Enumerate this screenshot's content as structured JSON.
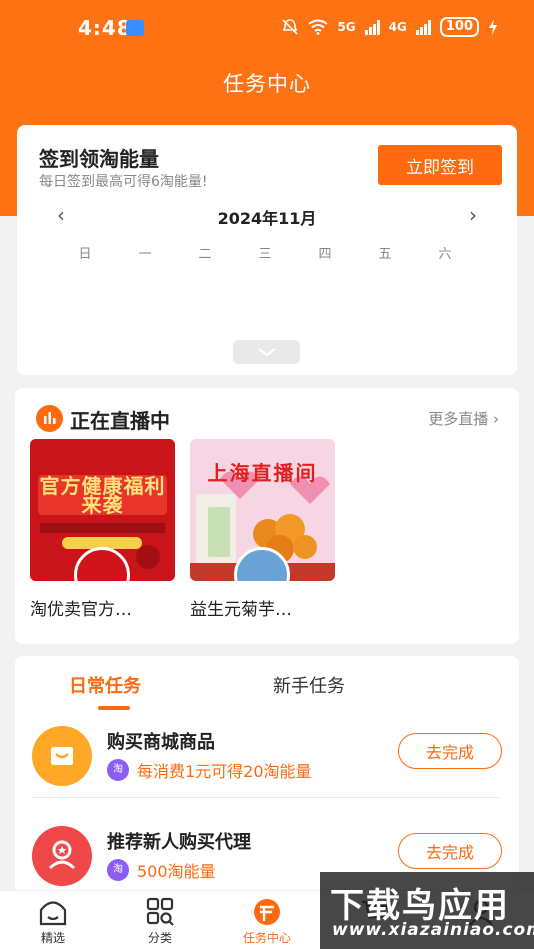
{
  "status_bar": {
    "time": "4:48",
    "network_5g": "5G",
    "network_4g": "4G",
    "battery": "100"
  },
  "header": {
    "title": "任务中心"
  },
  "signin": {
    "title": "签到领淘能量",
    "subtitle": "每日签到最高可得6淘能量!",
    "button_label": "立即签到",
    "month": "2024年11月",
    "weekdays": [
      "日",
      "一",
      "二",
      "三",
      "四",
      "五",
      "六"
    ]
  },
  "live": {
    "title": "正在直播中",
    "more_label": "更多直播",
    "streams": [
      {
        "name": "淘优卖官方…",
        "banner_text": "官方健康福利来袭"
      },
      {
        "name": "益生元菊芋…",
        "banner_text": "上海直播间"
      }
    ]
  },
  "tasks": {
    "tabs": [
      {
        "label": "日常任务",
        "active": true
      },
      {
        "label": "新手任务",
        "active": false
      }
    ],
    "items": [
      {
        "title": "购买商城商品",
        "badge": "淘",
        "reward": "每消费1元可得20淘能量",
        "button_label": "去完成"
      },
      {
        "title": "推荐新人购买代理",
        "badge": "淘",
        "reward": "500淘能量",
        "button_label": "去完成"
      }
    ]
  },
  "bottom_nav": {
    "items": [
      {
        "label": "精选",
        "icon": "home-icon"
      },
      {
        "label": "分类",
        "icon": "category-icon"
      },
      {
        "label": "任务中心",
        "icon": "task-icon"
      },
      {
        "label": "",
        "icon": "cart-icon"
      },
      {
        "label": "",
        "icon": "profile-icon"
      }
    ]
  },
  "watermark": {
    "main": "下载鸟应用",
    "url": "www.xiazainiao.com"
  },
  "colors": {
    "accent": "#fd6a10",
    "header_bg": "#fd7213",
    "purple_badge": "#8b5cf6"
  }
}
